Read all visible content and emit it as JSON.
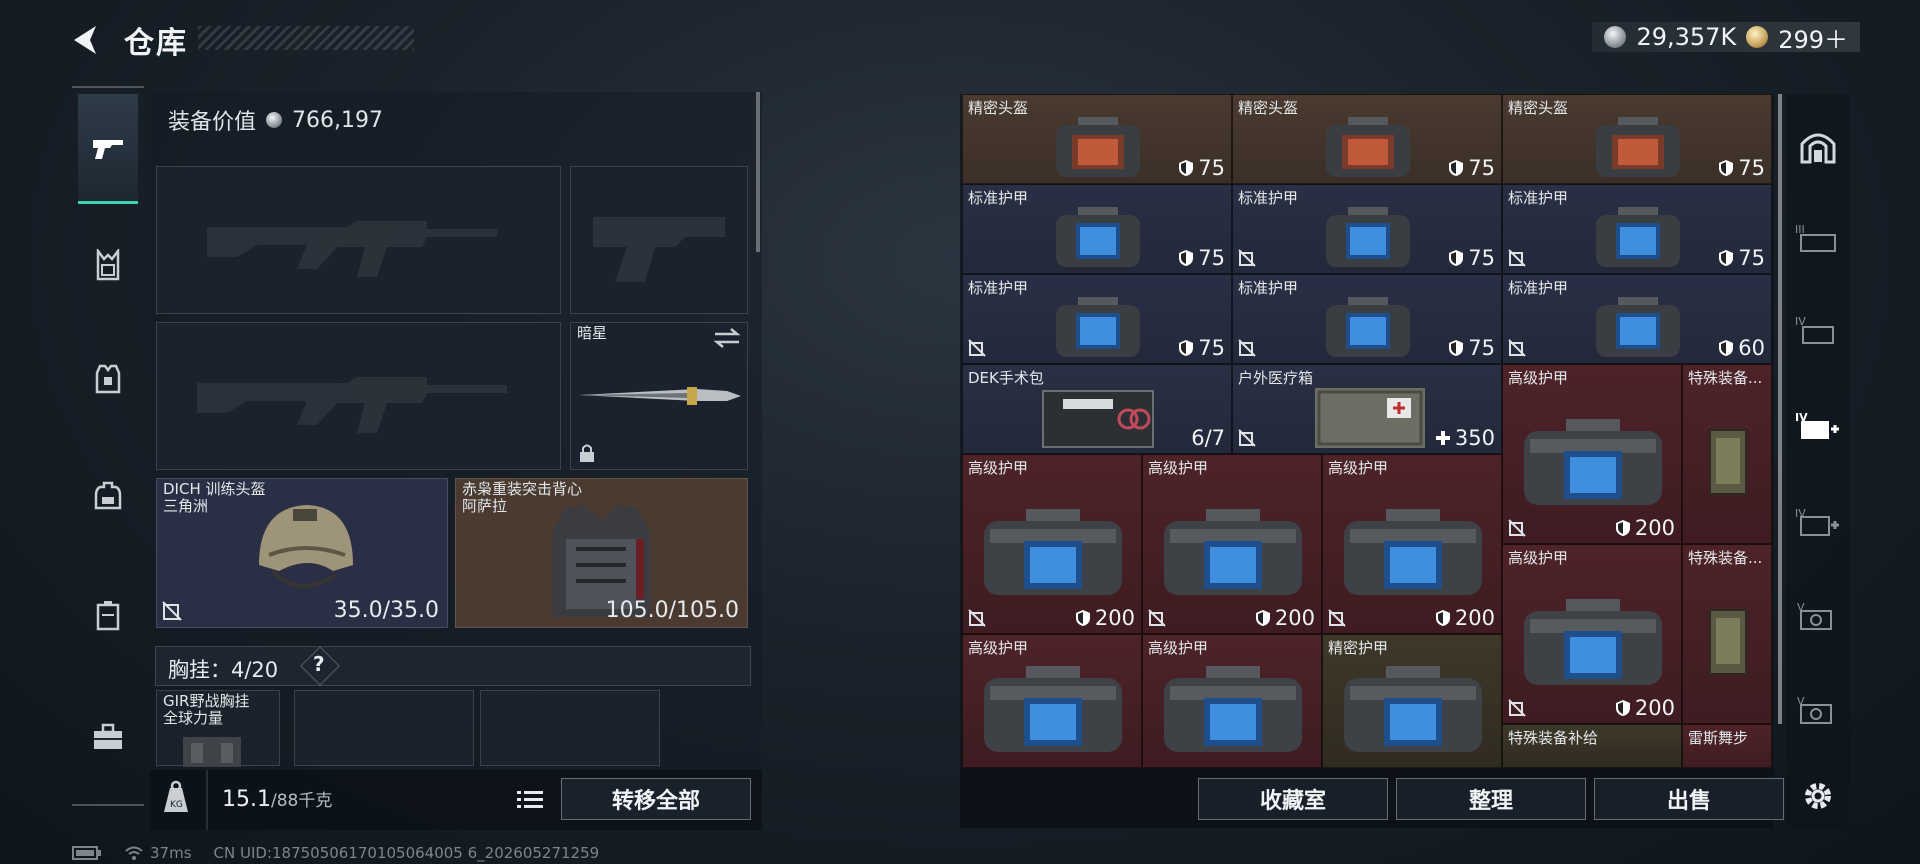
{
  "header": {
    "title": "仓库",
    "currency_silver": "29,357K",
    "currency_gold": "299＋"
  },
  "loadout": {
    "equip_value_label": "装备价值",
    "equip_value": "766,197",
    "melee_name": "暗星",
    "helmet": {
      "name": "DICH 训练头盔",
      "sub": "三角洲",
      "value": "35.0/35.0"
    },
    "armor": {
      "name": "赤枭重装突击背心",
      "sub": "阿萨拉",
      "value": "105.0/105.0"
    },
    "chest_label": "胸挂：",
    "chest_count": "4/20",
    "chest_help": "?",
    "chest_item": {
      "name": "GIR野战胸挂",
      "sub": "全球力量"
    },
    "weight": "15.1",
    "weight_max": "/88千克",
    "transfer_all": "转移全部"
  },
  "storage": {
    "cells": [
      {
        "name": "精密头盔",
        "val": "75",
        "color": "brown"
      },
      {
        "name": "精密头盔",
        "val": "75",
        "color": "brown"
      },
      {
        "name": "精密头盔",
        "val": "75",
        "color": "brown"
      },
      {
        "name": "标准护甲",
        "val": "75",
        "color": "navy"
      },
      {
        "name": "标准护甲",
        "val": "75",
        "color": "navy"
      },
      {
        "name": "标准护甲",
        "val": "75",
        "color": "navy"
      },
      {
        "name": "标准护甲",
        "val": "75",
        "color": "navy"
      },
      {
        "name": "标准护甲",
        "val": "75",
        "color": "navy"
      },
      {
        "name": "标准护甲",
        "val": "60",
        "color": "navy"
      },
      {
        "name": "DEK手术包",
        "val": "6/7",
        "color": "navy"
      },
      {
        "name": "户外医疗箱",
        "val": "350",
        "color": "navy"
      },
      {
        "name": "高级护甲",
        "val": "200",
        "color": "red"
      },
      {
        "name": "特殊装备...",
        "val": "",
        "color": "red"
      },
      {
        "name": "高级护甲",
        "val": "200",
        "color": "red"
      },
      {
        "name": "高级护甲",
        "val": "200",
        "color": "red"
      },
      {
        "name": "高级护甲",
        "val": "200",
        "color": "red"
      },
      {
        "name": "高级护甲",
        "val": "200",
        "color": "red"
      },
      {
        "name": "特殊装备...",
        "val": "",
        "color": "red"
      },
      {
        "name": "高级护甲",
        "val": "",
        "color": "red"
      },
      {
        "name": "高级护甲",
        "val": "",
        "color": "red"
      },
      {
        "name": "精密护甲",
        "val": "",
        "color": "olive"
      },
      {
        "name": "特殊装备补给",
        "val": "",
        "color": "olive"
      },
      {
        "name": "雷斯舞步",
        "val": "",
        "color": "red"
      }
    ],
    "buttons": {
      "collection": "收藏室",
      "sort": "整理",
      "sell": "出售"
    }
  },
  "status": {
    "ping": "37ms",
    "uid": "CN UID:18750506170105064005 6_202605271259"
  }
}
